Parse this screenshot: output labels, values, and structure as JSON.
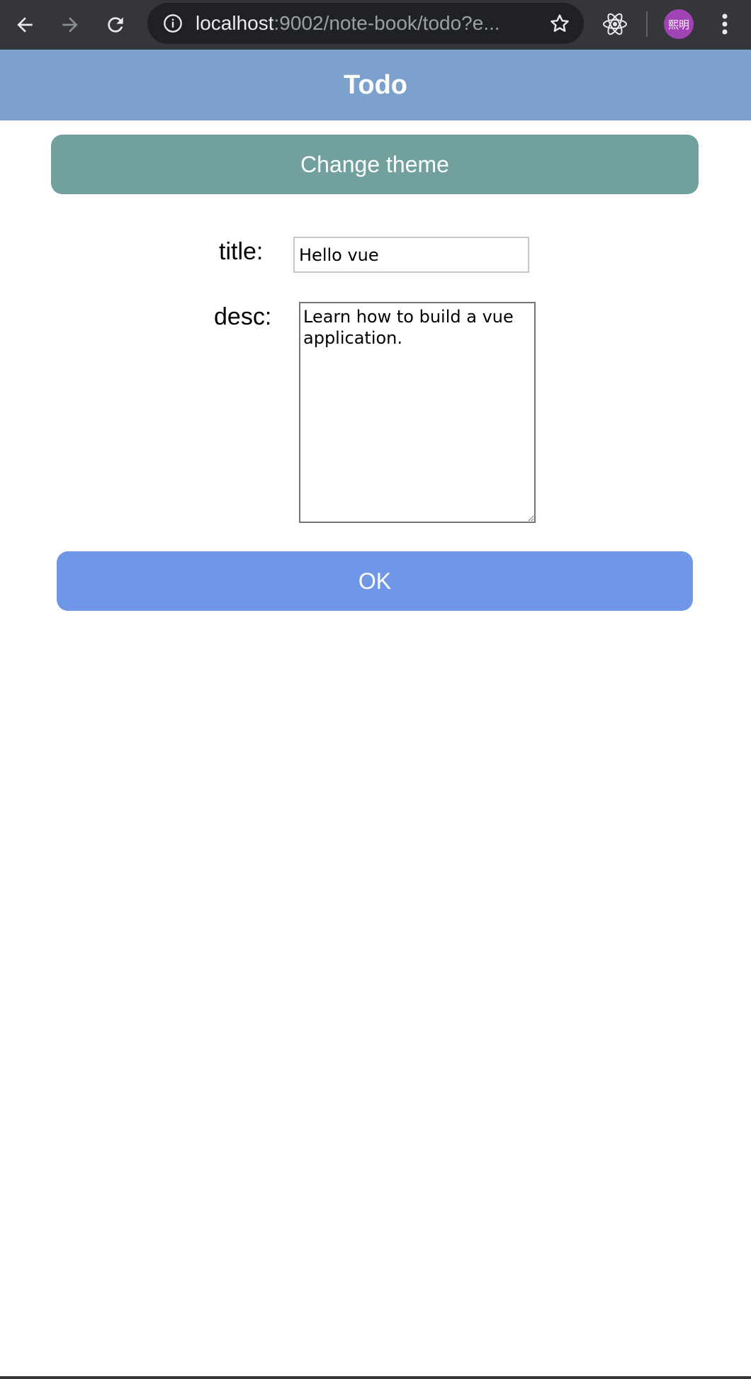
{
  "browser": {
    "url_host": "localhost",
    "url_rest": ":9002/note-book/todo?e...",
    "avatar_text": "熙明",
    "icons": [
      "back-arrow-icon",
      "forward-arrow-icon",
      "reload-icon",
      "info-icon",
      "bookmark-star-icon",
      "react-devtools-icon",
      "kebab-menu-icon"
    ]
  },
  "header": {
    "title": "Todo"
  },
  "theme_button": {
    "label": "Change theme"
  },
  "form": {
    "title_label": "title:",
    "title_value": "Hello vue",
    "desc_label": "desc:",
    "desc_value": "Learn how to build a vue application."
  },
  "ok_button": {
    "label": "OK"
  },
  "colors": {
    "browser_bar": "#35363a",
    "header_bg": "#7ba1cc",
    "theme_button_bg": "#71a09e",
    "ok_button_bg": "#7096e8"
  }
}
